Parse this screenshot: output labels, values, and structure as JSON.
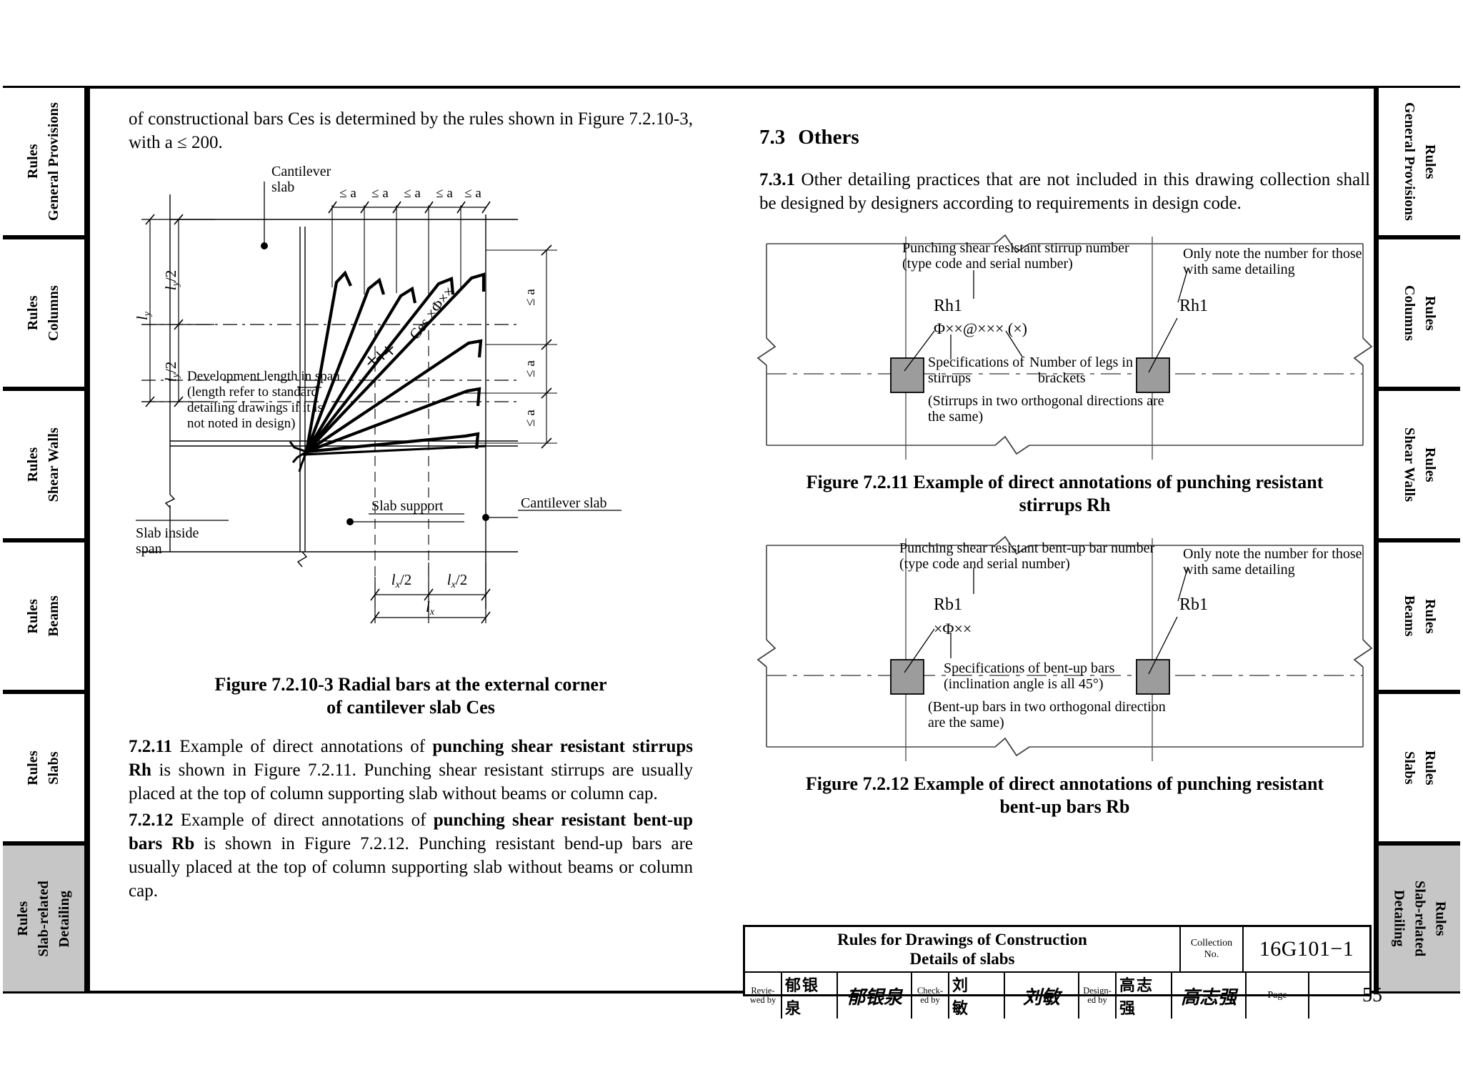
{
  "document": {
    "standard_code": "16G101-1",
    "page_number": "55"
  },
  "side_tabs": {
    "items": [
      {
        "line1": "Rules",
        "line2": "General Provisions",
        "active": false
      },
      {
        "line1": "Rules",
        "line2": "Columns",
        "active": false
      },
      {
        "line1": "Rules",
        "line2": "Shear Walls",
        "active": false
      },
      {
        "line1": "Rules",
        "line2": "Beams",
        "active": false
      },
      {
        "line1": "Rules",
        "line2": "Slabs",
        "active": false
      },
      {
        "line1": "Rules",
        "line2": "Slab-related\nDetailing",
        "active": true
      }
    ],
    "active_label_line2a": "Slab-related",
    "active_label_line2b": "Detailing"
  },
  "left_column": {
    "intro_paragraph": "of constructional bars Ces is determined by the rules shown in Figure 7.2.10-3, with a ≤ 200.",
    "figure_10_3": {
      "caption_line1": "Figure 7.2.10-3 Radial bars at the external corner",
      "caption_line2": "of cantilever slab Ces",
      "labels": {
        "cantilever_slab_top": "Cantilever\nslab",
        "cantilever_slab_top_l1": "Cantilever",
        "cantilever_slab_top_l2": "slab",
        "cantilever_slab_right": "Cantilever slab",
        "slab_support": "Slab support",
        "slab_inside_span_l1": "Slab inside",
        "slab_inside_span_l2": "span",
        "development_l1": "Development length in span",
        "development_l2": "(length refer to standard",
        "development_l3": "detailing drawings if it is",
        "development_l4": "not noted in design)",
        "bar_mark": "Ces ×Φ××",
        "dim_le_a": "≤ a",
        "dim_ly": "l",
        "dim_ly_sub": "y",
        "dim_ly_half": "l y /2",
        "dim_lx_half": "l x /2",
        "dim_lx": "l x"
      }
    },
    "clause_7_2_11": {
      "number": "7.2.11",
      "text_a": "Example of direct annotations of ",
      "bold_a": "punching shear resistant stirrups Rh",
      "text_b": " is shown in Figure 7.2.11. Punching shear resistant stirrups are usually placed at the top of column supporting slab without beams or column cap."
    },
    "clause_7_2_12": {
      "number": "7.2.12",
      "text_a": "Example of direct annotations of ",
      "bold_a": "punching shear resistant bent-up bars Rb",
      "text_b": " is shown in Figure 7.2.12. Punching resistant bend-up bars are usually placed at the top of column supporting slab without beams or column cap."
    }
  },
  "right_column": {
    "section_7_3": {
      "number": "7.3",
      "title": "Others"
    },
    "clause_7_3_1": {
      "number": "7.3.1",
      "text": "Other detailing practices that are not included in this drawing collection shall be designed by designers according to requirements in design code."
    },
    "figure_11": {
      "caption_line1": "Figure 7.2.11 Example of direct annotations of punching resistant",
      "caption_line2": "stirrups Rh",
      "labels": {
        "note_top_l1": "Punching shear resistant stirrup number",
        "note_top_l2": "(type code and serial number)",
        "note_right_l1": "Only note the number for those",
        "note_right_l2": "with same detailing",
        "mark_left": "Rh1",
        "mark_right": "Rh1",
        "spec_code": "Φ××@××× (×)",
        "spec_label_l1": "Specifications of",
        "spec_label_l2": "stirrups",
        "legs_label_l1": "Number of legs in",
        "legs_label_l2": "brackets",
        "paren_l1": "(Stirrups in two orthogonal directions are",
        "paren_l2": "the same)"
      }
    },
    "figure_12": {
      "caption_line1": "Figure 7.2.12 Example of direct annotations of punching resistant",
      "caption_line2": "bent-up bars Rb",
      "labels": {
        "note_top_l1": "Punching shear resistant bent-up bar number",
        "note_top_l2": "(type code and serial number)",
        "note_right_l1": "Only note the number for those",
        "note_right_l2": "with same detailing",
        "mark_left": "Rb1",
        "mark_right": "Rb1",
        "spec_code": "×Φ××",
        "spec_label_l1": "Specifications of bent-up bars",
        "spec_label_l2": "(inclination angle is all 45°)",
        "paren_l1": "(Bent-up bars in two orthogonal direction",
        "paren_l2": "are the same)"
      }
    }
  },
  "title_block": {
    "title_line1": "Rules for Drawings of Construction",
    "title_line2": "Details of slabs",
    "collection_label_l1": "Collection",
    "collection_label_l2": "No.",
    "collection_value": "16G101−1",
    "page_label": "Page",
    "page_value": "55",
    "reviewed_label_l1": "Revie-",
    "reviewed_label_l2": "wed by",
    "reviewed_name": "郁银泉",
    "reviewed_sign": "郁银泉",
    "checked_label_l1": "Check-",
    "checked_label_l2": "ed by",
    "checked_name": "刘　敏",
    "checked_sign": "刘敏",
    "designed_label_l1": "Design-",
    "designed_label_l2": "ed by",
    "designed_name": "高志强",
    "designed_sign": "高志强"
  }
}
